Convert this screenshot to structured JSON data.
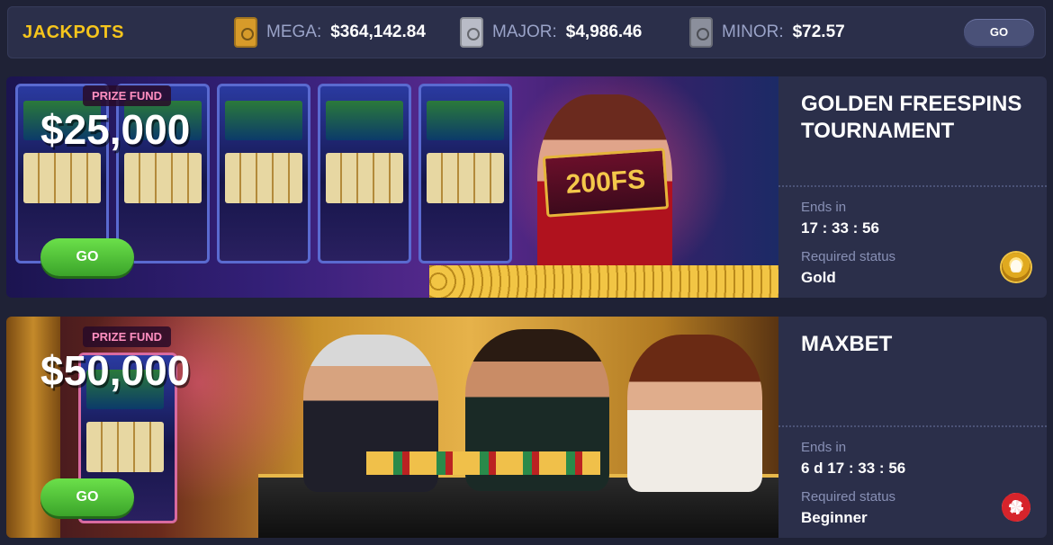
{
  "jackpots": {
    "title": "JACKPOTS",
    "items": [
      {
        "label": "MEGA:",
        "value": "$364,142.84",
        "icon": "gold-safe-icon",
        "color": "#d79b2a"
      },
      {
        "label": "MAJOR:",
        "value": "$4,986.46",
        "icon": "silver-safe-icon",
        "color": "#b9bcc7"
      },
      {
        "label": "MINOR:",
        "value": "$72.57",
        "icon": "grey-safe-icon",
        "color": "#8b8f9c"
      }
    ],
    "go_label": "GO"
  },
  "tournaments": [
    {
      "name": "GOLDEN FREESPINS TOURNAMENT",
      "prize_label": "PRIZE FUND",
      "prize_value": "$25,000",
      "banner_badge": "200FS",
      "go_label": "GO",
      "ends_label": "Ends in",
      "ends_value": "17 : 33 : 56",
      "status_label": "Required status",
      "status_value": "Gold",
      "status_icon": "gold-status-icon"
    },
    {
      "name": "MAXBET",
      "prize_label": "PRIZE FUND",
      "prize_value": "$50,000",
      "go_label": "GO",
      "ends_label": "Ends in",
      "ends_value": "6 d 17 : 33 : 56",
      "status_label": "Required status",
      "status_value": "Beginner",
      "status_icon": "beginner-chip-icon"
    }
  ],
  "colors": {
    "background": "#1f2236",
    "panel": "#2b2f4a",
    "accent_yellow": "#f5c51c",
    "go_green": "#4fc43a"
  }
}
